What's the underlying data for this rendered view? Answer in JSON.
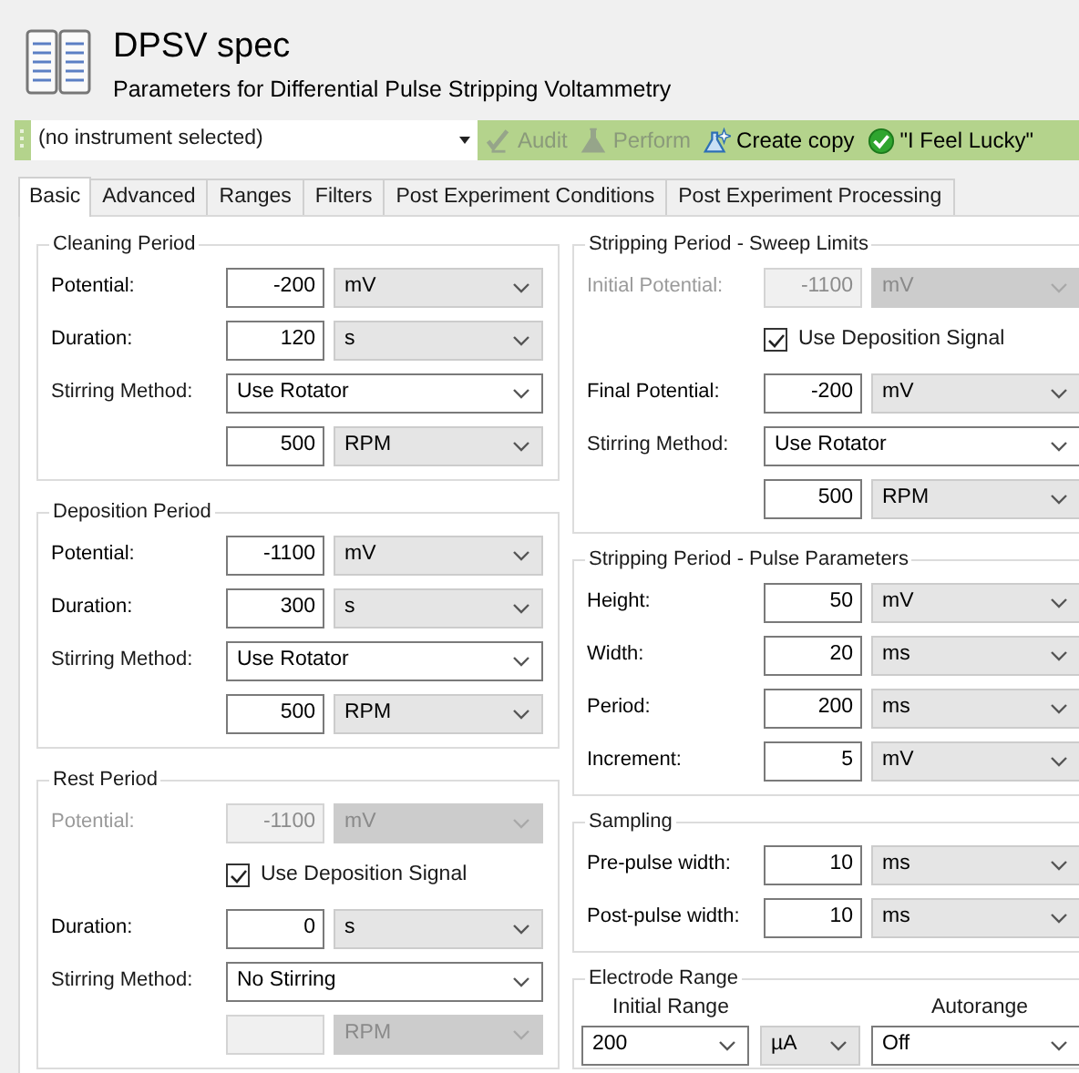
{
  "header": {
    "title": "DPSV spec",
    "subtitle": "Parameters for Differential Pulse Stripping Voltammetry"
  },
  "toolbar": {
    "instrument": "(no instrument selected)",
    "buttons": [
      {
        "kind": "audit",
        "label": "Audit",
        "disabled": true
      },
      {
        "kind": "perform",
        "label": "Perform",
        "disabled": true
      },
      {
        "kind": "copy",
        "label": "Create copy",
        "disabled": false
      },
      {
        "kind": "lucky",
        "label": "\"I Feel Lucky\"",
        "disabled": false
      }
    ]
  },
  "tabs": [
    {
      "label": "Basic",
      "selected": true
    },
    {
      "label": "Advanced",
      "selected": false
    },
    {
      "label": "Ranges",
      "selected": false
    },
    {
      "label": "Filters",
      "selected": false
    },
    {
      "label": "Post Experiment Conditions",
      "selected": false
    },
    {
      "label": "Post Experiment Processing",
      "selected": false
    }
  ],
  "left_column": [
    {
      "title": "Cleaning Period",
      "rows": [
        {
          "kind": "value",
          "label": "Potential:",
          "value": "-200",
          "unit": "mV",
          "disabled": false
        },
        {
          "kind": "value",
          "label": "Duration:",
          "value": "120",
          "unit": "s",
          "disabled": false
        },
        {
          "kind": "choice",
          "label": "Stirring Method:",
          "value": "Use Rotator"
        },
        {
          "kind": "rpm",
          "value": "500",
          "unit": "RPM",
          "disabled": false
        }
      ]
    },
    {
      "title": "Deposition Period",
      "rows": [
        {
          "kind": "value",
          "label": "Potential:",
          "value": "-1100",
          "unit": "mV",
          "disabled": false
        },
        {
          "kind": "value",
          "label": "Duration:",
          "value": "300",
          "unit": "s",
          "disabled": false
        },
        {
          "kind": "choice",
          "label": "Stirring Method:",
          "value": "Use Rotator"
        },
        {
          "kind": "rpm",
          "value": "500",
          "unit": "RPM",
          "disabled": false
        }
      ]
    },
    {
      "title": "Rest Period",
      "rows": [
        {
          "kind": "value",
          "label": "Potential:",
          "value": "-1100",
          "unit": "mV",
          "disabled": true
        },
        {
          "kind": "checkbox",
          "label": "Use Deposition Signal",
          "checked": true
        },
        {
          "kind": "value",
          "label": "Duration:",
          "value": "0",
          "unit": "s",
          "disabled": false
        },
        {
          "kind": "choice",
          "label": "Stirring Method:",
          "value": "No Stirring"
        },
        {
          "kind": "rpm",
          "unit": "RPM",
          "disabled": true
        }
      ]
    }
  ],
  "right_column": [
    {
      "title": "Stripping Period - Sweep Limits",
      "rows": [
        {
          "kind": "value",
          "label": "Initial Potential:",
          "value": "-1100",
          "unit": "mV",
          "disabled": true
        },
        {
          "kind": "checkbox",
          "label": "Use Deposition Signal",
          "checked": true
        },
        {
          "kind": "value",
          "label": "Final Potential:",
          "value": "-200",
          "unit": "mV",
          "disabled": false
        },
        {
          "kind": "choice",
          "label": "Stirring Method:",
          "value": "Use Rotator"
        },
        {
          "kind": "rpm",
          "value": "500",
          "unit": "RPM",
          "disabled": false
        }
      ]
    },
    {
      "title": "Stripping Period - Pulse Parameters",
      "rows": [
        {
          "kind": "value",
          "label": "Height:",
          "value": "50",
          "unit": "mV",
          "disabled": false
        },
        {
          "kind": "value",
          "label": "Width:",
          "value": "20",
          "unit": "ms",
          "disabled": false
        },
        {
          "kind": "value",
          "label": "Period:",
          "value": "200",
          "unit": "ms",
          "disabled": false
        },
        {
          "kind": "value",
          "label": "Increment:",
          "value": "5",
          "unit": "mV",
          "disabled": false
        }
      ]
    },
    {
      "title": "Sampling",
      "rows": [
        {
          "kind": "value",
          "label": "Pre-pulse width:",
          "value": "10",
          "unit": "ms",
          "disabled": false
        },
        {
          "kind": "value",
          "label": "Post-pulse width:",
          "value": "10",
          "unit": "ms",
          "disabled": false
        }
      ]
    },
    {
      "title": "Electrode Range",
      "rows": [
        {
          "kind": "range",
          "range_heading": "Initial Range",
          "autorange_heading": "Autorange",
          "range": "200",
          "range_unit": "µA",
          "autorange": "Off"
        }
      ]
    }
  ]
}
